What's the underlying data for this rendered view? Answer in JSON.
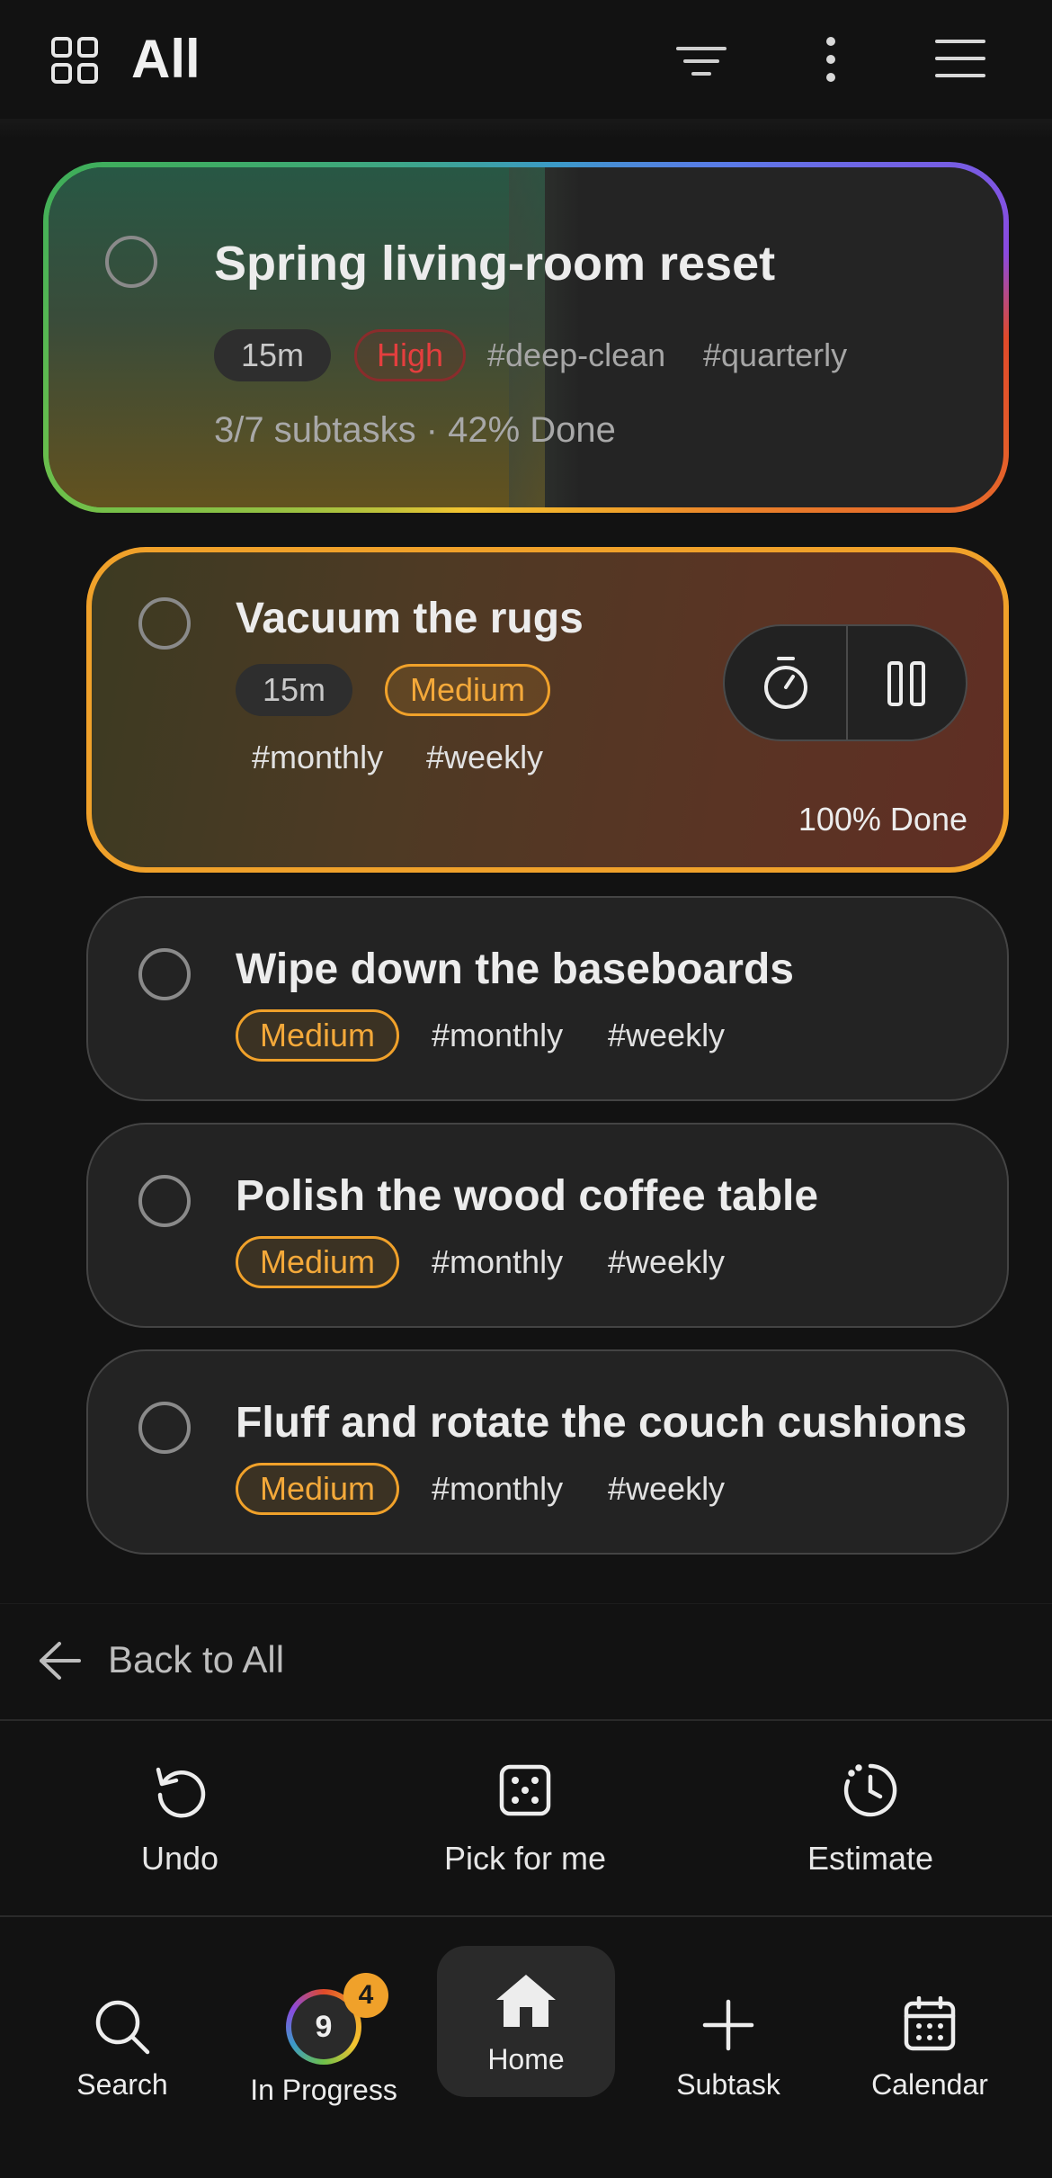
{
  "header": {
    "title": "All",
    "icons": [
      "grid-icon",
      "filter-icon",
      "more-vertical-icon",
      "menu-icon"
    ]
  },
  "parent_task": {
    "title": "Spring living-room reset",
    "duration": "15m",
    "priority": "High",
    "tags": [
      "#deep-clean",
      "#quarterly"
    ],
    "progress_text": "3/7 subtasks · 42% Done",
    "progress_fraction": 0.42
  },
  "subtasks": [
    {
      "title": "Vacuum the rugs",
      "duration": "15m",
      "priority": "Medium",
      "tags": [
        "#monthly",
        "#weekly"
      ],
      "status": "100% Done",
      "active": true
    },
    {
      "title": "Wipe down the baseboards",
      "priority": "Medium",
      "tags": [
        "#monthly",
        "#weekly"
      ]
    },
    {
      "title": "Polish the wood coffee table",
      "priority": "Medium",
      "tags": [
        "#monthly",
        "#weekly"
      ]
    },
    {
      "title": "Fluff and rotate the couch cushions",
      "priority": "Medium",
      "tags": [
        "#monthly",
        "#weekly"
      ]
    }
  ],
  "back": {
    "label": "Back to All"
  },
  "actions": {
    "undo": "Undo",
    "pick": "Pick for me",
    "estimate": "Estimate"
  },
  "nav": {
    "search": "Search",
    "in_progress": "In Progress",
    "in_progress_count": "9",
    "in_progress_badge": "4",
    "home": "Home",
    "subtask": "Subtask",
    "calendar": "Calendar",
    "active": "Home"
  },
  "colors": {
    "background": "#121212",
    "card": "#232323",
    "medium": "#f0a12a",
    "high": "#e43e3e",
    "active_border": "#f0a12a",
    "badge": "#f0a12a"
  }
}
